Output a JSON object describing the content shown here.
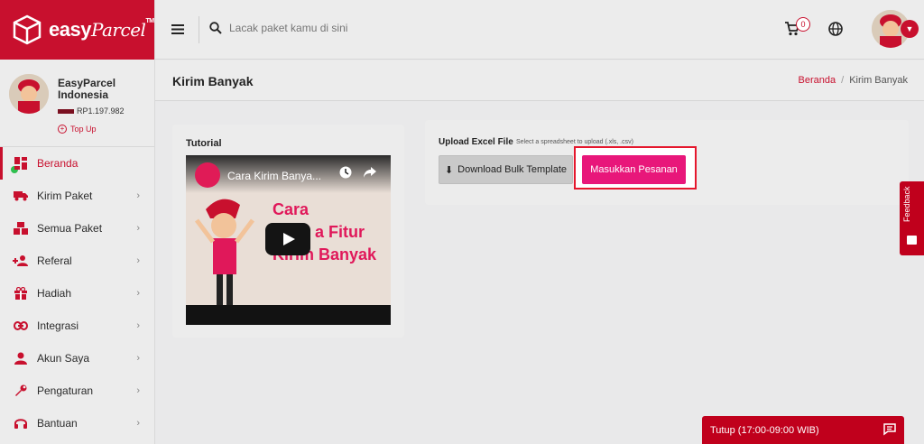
{
  "brand": {
    "name": "easy",
    "name_script": "Parcel",
    "tm": "TM"
  },
  "header": {
    "search_placeholder": "Lacak paket kamu di sini",
    "cart_count": "0"
  },
  "profile": {
    "name": "EasyParcel Indonesia",
    "balance": "RP1.197.982",
    "topup_label": "Top Up"
  },
  "sidebar": {
    "items": [
      {
        "label": "Beranda",
        "icon": "dashboard-icon",
        "active": true
      },
      {
        "label": "Kirim Paket",
        "icon": "truck-icon"
      },
      {
        "label": "Semua Paket",
        "icon": "boxes-icon"
      },
      {
        "label": "Referal",
        "icon": "user-plus-icon"
      },
      {
        "label": "Hadiah",
        "icon": "gift-icon"
      },
      {
        "label": "Integrasi",
        "icon": "link-icon"
      },
      {
        "label": "Akun Saya",
        "icon": "user-icon"
      },
      {
        "label": "Pengaturan",
        "icon": "wrench-icon"
      },
      {
        "label": "Bantuan",
        "icon": "headset-icon"
      }
    ]
  },
  "page": {
    "title": "Kirim Banyak",
    "breadcrumb": {
      "home": "Beranda",
      "current": "Kirim Banyak"
    }
  },
  "tutorial": {
    "label": "Tutorial",
    "video_title": "Cara Kirim Banya...",
    "video_text_1": "Cara",
    "video_text_2": "a Fitur",
    "video_text_3": "Kirim Banyak"
  },
  "upload": {
    "label": "Upload Excel File",
    "hint": "Select a spreadsheet to upload (.xls, .csv)",
    "download_button": "Download Bulk Template",
    "submit_button": "Masukkan Pesanan"
  },
  "feedback": {
    "label": "Feedback"
  },
  "chat": {
    "label": "Tutup (17:00-09:00 WIB)"
  },
  "colors": {
    "brand": "#c8102e",
    "accent": "#e8177a"
  }
}
